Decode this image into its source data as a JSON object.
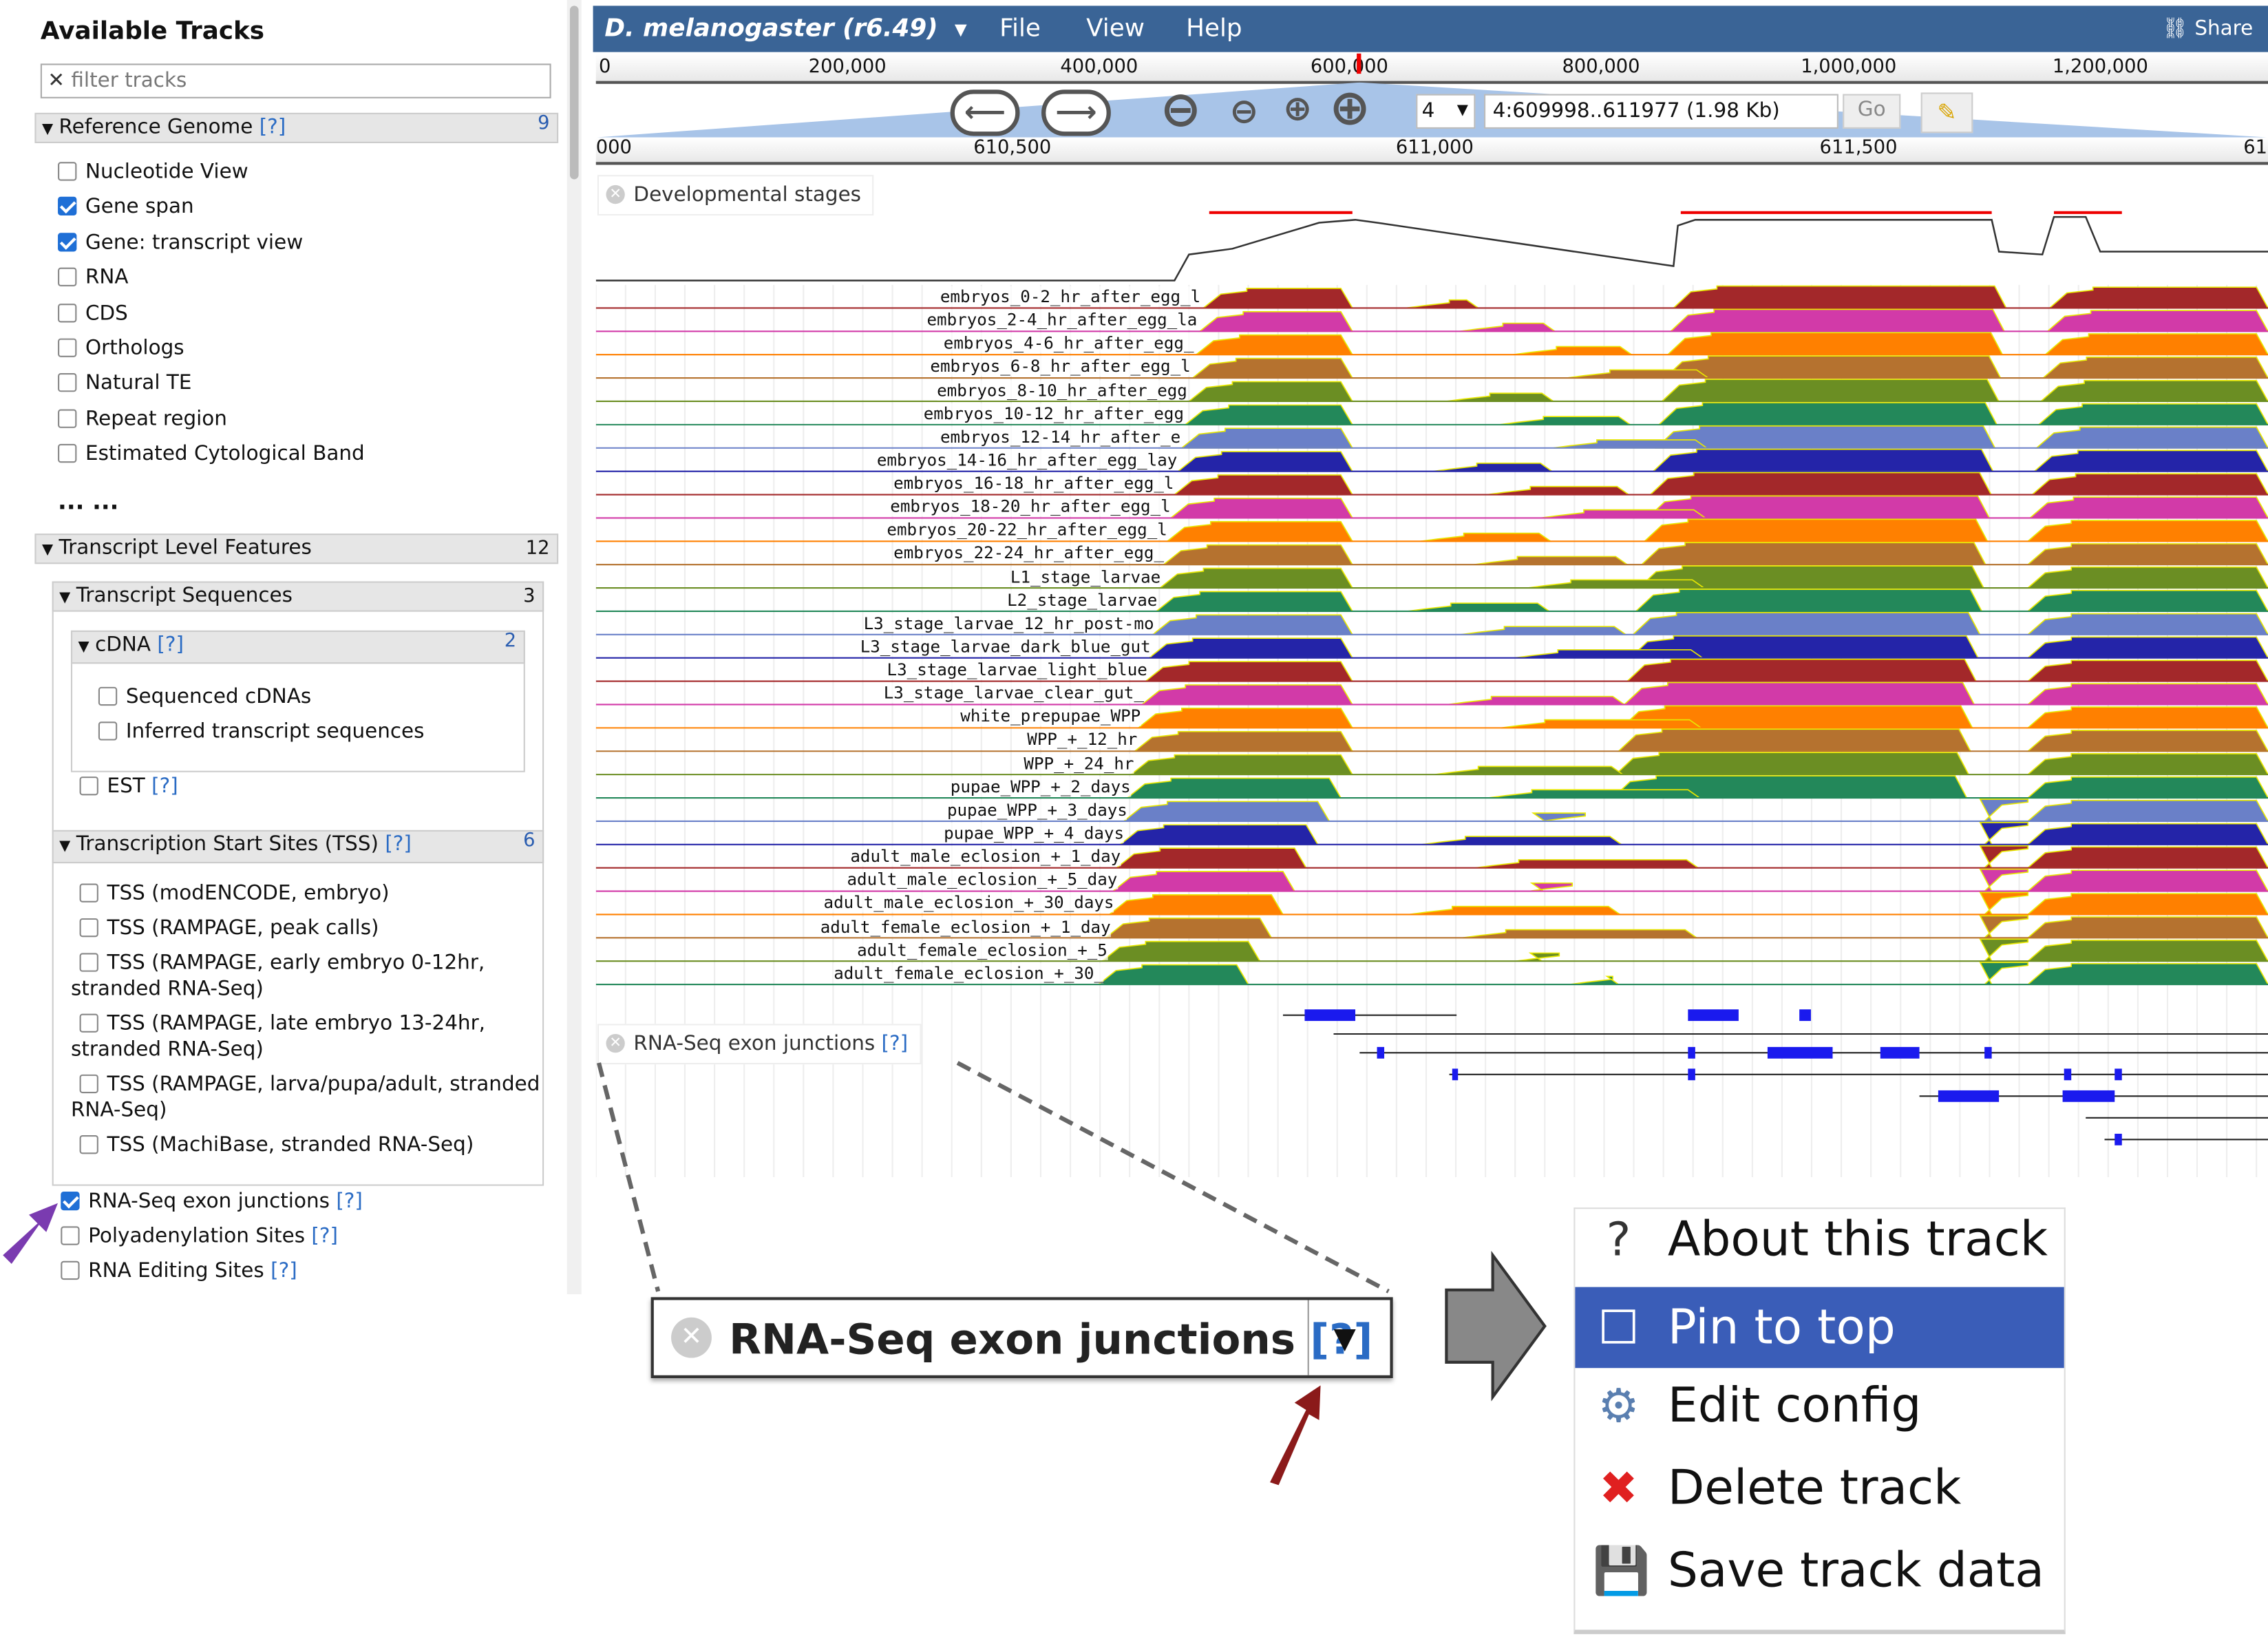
{
  "sidebar": {
    "title": "Available Tracks",
    "filter_placeholder": "filter tracks",
    "reference_genome": {
      "label": "Reference Genome",
      "help": "[?]",
      "count": "9",
      "items": [
        {
          "label": "Nucleotide View",
          "checked": false
        },
        {
          "label": "Gene span",
          "checked": true
        },
        {
          "label": "Gene: transcript view",
          "checked": true
        },
        {
          "label": "RNA",
          "checked": false
        },
        {
          "label": "CDS",
          "checked": false
        },
        {
          "label": "Orthologs",
          "checked": false
        },
        {
          "label": "Natural TE",
          "checked": false
        },
        {
          "label": "Repeat region",
          "checked": false
        },
        {
          "label": "Estimated Cytological Band",
          "checked": false
        }
      ]
    },
    "ellipsis": "... ...",
    "transcript_level": {
      "label": "Transcript Level Features",
      "count": "12"
    },
    "transcript_sequences": {
      "label": "Transcript Sequences",
      "count": "3"
    },
    "cdna": {
      "label": "cDNA",
      "help": "[?]",
      "count": "2",
      "items": [
        "Sequenced cDNAs",
        "Inferred transcript sequences"
      ]
    },
    "est": {
      "label": "EST",
      "help": "[?]"
    },
    "tss": {
      "label": "Transcription Start Sites (TSS)",
      "help": "[?]",
      "count": "6",
      "items": [
        [
          "TSS (modENCODE, embryo)"
        ],
        [
          "TSS (RAMPAGE, peak calls)"
        ],
        [
          "TSS (RAMPAGE, early embryo 0-12hr,",
          "stranded RNA-Seq)"
        ],
        [
          "TSS (RAMPAGE, late embryo 13-24hr,",
          "stranded RNA-Seq)"
        ],
        [
          "TSS (RAMPAGE, larva/pupa/adult, stranded",
          "RNA-Seq)"
        ],
        [
          "TSS (MachiBase, stranded RNA-Seq)"
        ]
      ]
    },
    "bottom_items": [
      {
        "label": "RNA-Seq exon junctions",
        "help": "[?]",
        "checked": true
      },
      {
        "label": "Polyadenylation Sites",
        "help": "[?]",
        "checked": false
      },
      {
        "label": "RNA Editing Sites",
        "help": "[?]",
        "checked": false
      }
    ]
  },
  "menubar": {
    "genome": "D. melanogaster (r6.49)",
    "file": "File",
    "view": "View",
    "help": "Help",
    "share": "Share"
  },
  "overview_ruler": [
    "0",
    "200,000",
    "400,000",
    "600,000",
    "800,000",
    "1,000,000",
    "1,200,000"
  ],
  "nav": {
    "refseq": "4",
    "location": "4:609998..611977 (1.98 Kb)",
    "go": "Go"
  },
  "detail_ruler": [
    "000",
    "610,500",
    "611,000",
    "611,500",
    "61"
  ],
  "tracks": {
    "dev_stages": {
      "label": "Developmental stages",
      "rows": [
        "embryos_0-2_hr_after_egg_l",
        "embryos_2-4_hr_after_egg_la",
        "embryos_4-6_hr_after_egg_",
        "embryos_6-8_hr_after_egg_l",
        "embryos_8-10_hr_after_egg",
        "embryos_10-12_hr_after_egg",
        "embryos_12-14_hr_after_e",
        "embryos_14-16_hr_after_egg_lay",
        "embryos_16-18_hr_after_egg_l",
        "embryos_18-20_hr_after_egg_l",
        "embryos_20-22_hr_after_egg_l",
        "embryos_22-24_hr_after_egg_",
        "L1_stage_larvae",
        "L2_stage_larvae",
        "L3_stage_larvae_12_hr_post-mo",
        "L3_stage_larvae_dark_blue_gut",
        "L3_stage_larvae_light_blue",
        "L3_stage_larvae_clear_gut_",
        "white_prepupae_WPP",
        "WPP_+_12_hr",
        "WPP_+_24_hr",
        "pupae_WPP_+_2_days",
        "pupae_WPP_+_3_days",
        "pupae_WPP_+_4_days",
        "adult_male_eclosion_+_1_day",
        "adult_male_eclosion_+_5_day",
        "adult_male_eclosion_+_30_days",
        "adult_female_eclosion_+_1_day",
        "adult_female_eclosion_+_5",
        "adult_female_eclosion_+_30_"
      ],
      "colors": [
        "#a3282a",
        "#d23aa8",
        "#ff8000",
        "#b5722f",
        "#6b8e23",
        "#23885a",
        "#6a80c8",
        "#2424a8"
      ]
    },
    "junctions": {
      "label": "RNA-Seq exon junctions",
      "help": "[?]"
    }
  },
  "zoomed_header": {
    "label": "RNA-Seq exon junctions",
    "help": "[?]"
  },
  "track_menu": {
    "items": [
      {
        "label": "About this track",
        "icon": "question-icon"
      },
      {
        "label": "Pin to top",
        "icon": "checkbox-icon",
        "highlighted": true
      },
      {
        "label": "Edit config",
        "icon": "config-icon"
      },
      {
        "label": "Delete track",
        "icon": "delete-x-icon"
      },
      {
        "label": "Save track data",
        "icon": "floppy-disk-icon"
      }
    ]
  },
  "colors": {
    "menubar": "#3a6496",
    "highlight": "#3a5db8",
    "arrow_purple": "#7a3bb0",
    "arrow_darkred": "#8b1a1a"
  }
}
